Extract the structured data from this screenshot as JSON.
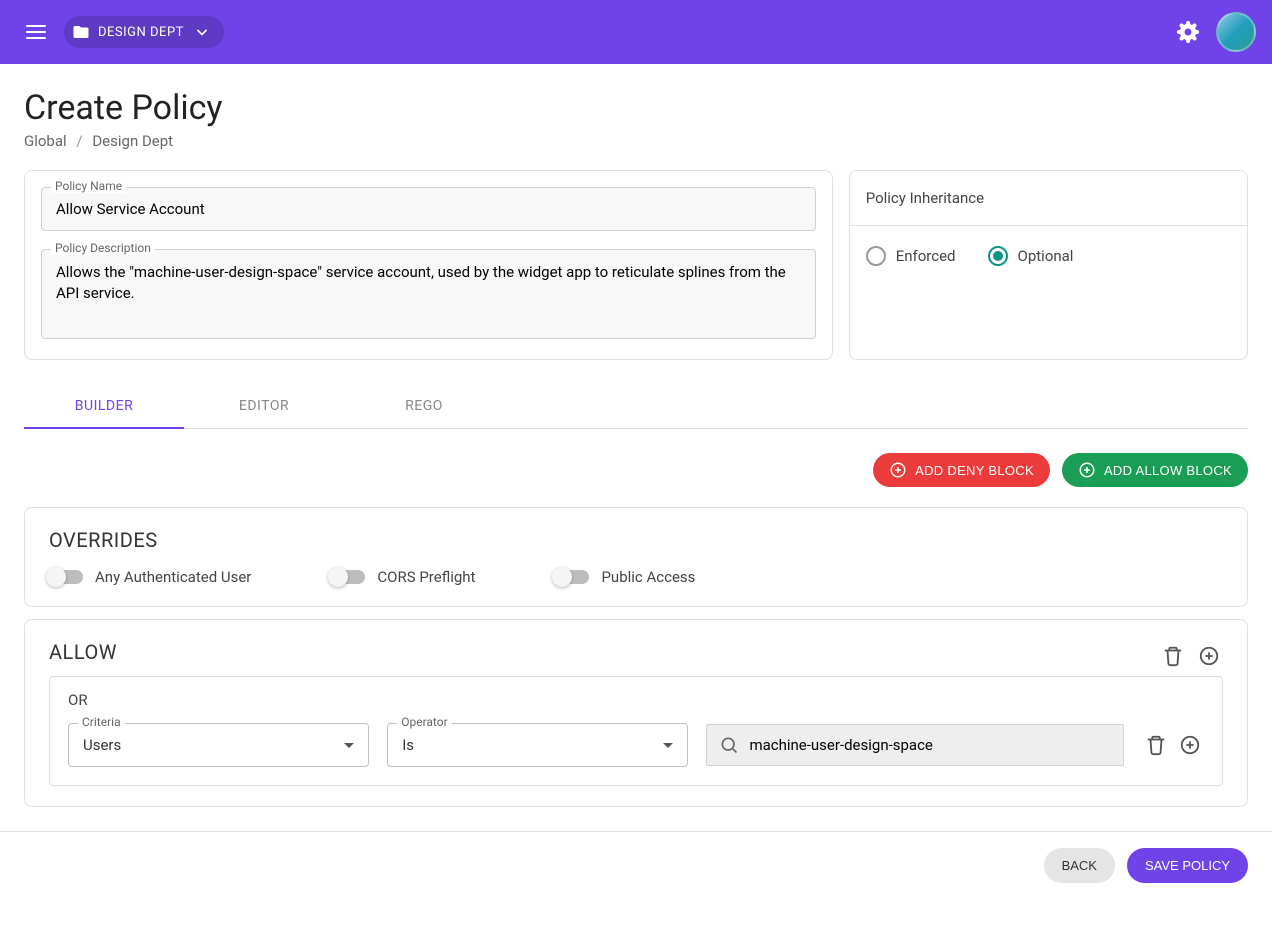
{
  "topbar": {
    "scope_label": "DESIGN DEPT"
  },
  "page": {
    "title": "Create Policy",
    "breadcrumb": {
      "root": "Global",
      "current": "Design Dept",
      "sep": "/"
    }
  },
  "policy": {
    "name_label": "Policy Name",
    "name_value": "Allow Service Account",
    "description_label": "Policy Description",
    "description_value": "Allows the \"machine-user-design-space\" service account, used by the widget app to reticulate splines from the API service."
  },
  "inheritance": {
    "title": "Policy Inheritance",
    "options": [
      {
        "label": "Enforced",
        "selected": false
      },
      {
        "label": "Optional",
        "selected": true
      }
    ]
  },
  "tabs": [
    {
      "label": "BUILDER",
      "active": true
    },
    {
      "label": "EDITOR",
      "active": false
    },
    {
      "label": "REGO",
      "active": false
    }
  ],
  "block_buttons": {
    "deny": "ADD DENY BLOCK",
    "allow": "ADD ALLOW BLOCK"
  },
  "overrides": {
    "title": "OVERRIDES",
    "toggles": [
      {
        "label": "Any Authenticated User"
      },
      {
        "label": "CORS Preflight"
      },
      {
        "label": "Public Access"
      }
    ]
  },
  "allow": {
    "title": "ALLOW",
    "group_label": "OR",
    "criteria_label": "Criteria",
    "criteria_value": "Users",
    "operator_label": "Operator",
    "operator_value": "Is",
    "search_value": "machine-user-design-space"
  },
  "footer": {
    "back": "BACK",
    "save": "SAVE POLICY"
  }
}
